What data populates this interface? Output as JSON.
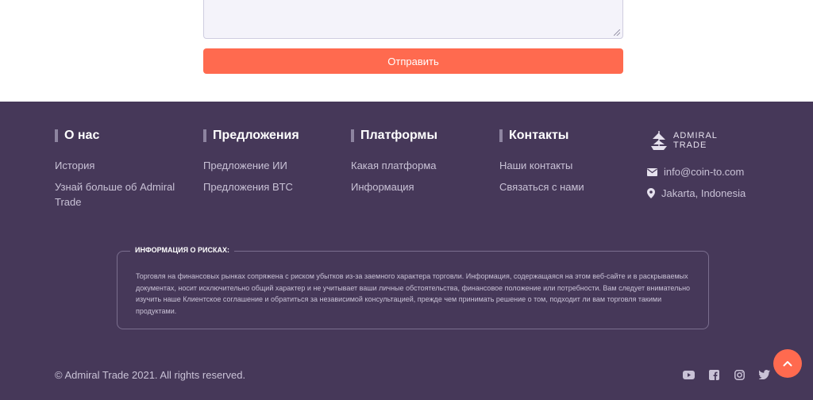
{
  "form": {
    "submit_label": "Отправить"
  },
  "footer": {
    "columns": [
      {
        "title": "О нас",
        "links": [
          "История",
          "Узнай больше об Admiral Trade"
        ]
      },
      {
        "title": "Предложения",
        "links": [
          "Предложение ИИ",
          "Предложения BTC"
        ]
      },
      {
        "title": "Платформы",
        "links": [
          "Какая платформа",
          "Информация"
        ]
      },
      {
        "title": "Контакты",
        "links": [
          "Наши контакты",
          "Связаться с нами"
        ]
      }
    ],
    "brand": {
      "line1": "ADMIRAL",
      "line2": "TRADE"
    },
    "contact": {
      "email": "info@coin-to.com",
      "location": "Jakarta, Indonesia"
    },
    "risk": {
      "title": "ИНФОРМАЦИЯ О РИСКАХ:",
      "text": "Торговля на финансовых рынках сопряжена с риском убытков из-за заемного характера торговли. Информация, содержащаяся на этом веб-сайте и в раскрываемых документах, носит исключительно общий характер и не учитывает ваши личные обстоятельства, финансовое положение или потребности. Вам следует внимательно изучить наше Клиентское соглашение и обратиться за независимой консультацией, прежде чем принимать решение о том, подходит ли вам торговля такими продуктами."
    },
    "copyright": "© Admiral Trade 2021. All rights reserved.",
    "socials": [
      "youtube-icon",
      "facebook-icon",
      "instagram-icon",
      "twitter-icon"
    ]
  },
  "colors": {
    "accent": "#ff6a4f",
    "footer_bg": "#463859"
  }
}
